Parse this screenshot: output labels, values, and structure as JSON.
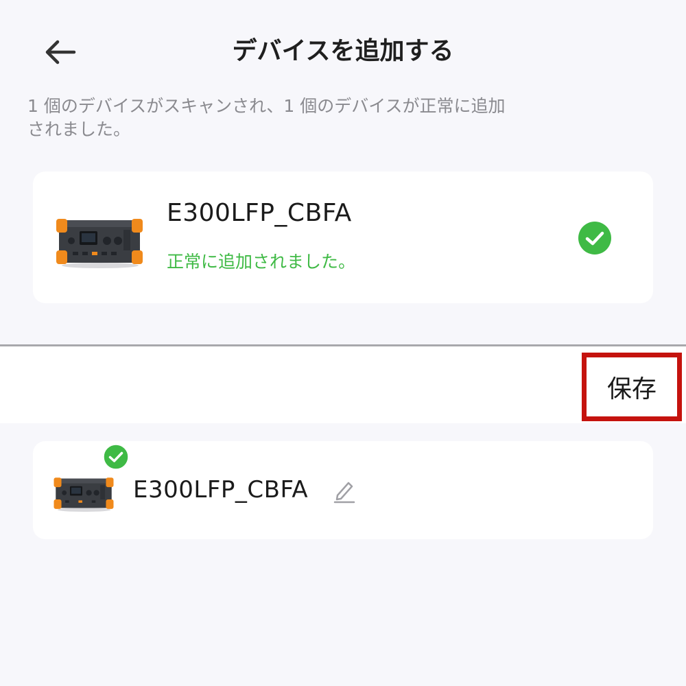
{
  "header": {
    "title": "デバイスを追加する",
    "back_icon": "arrow-left-icon"
  },
  "summary": {
    "line1": "1 個のデバイスがスキャンされ、1 個のデバイスが正常に追加",
    "line2": "されました。"
  },
  "scan_result": {
    "device_name": "E300LFP_CBFA",
    "status_text": "正常に追加されました。",
    "status_icon": "check-circle-icon",
    "status_color": "#3fba45"
  },
  "toolbar": {
    "save_label": "保存",
    "highlight_color": "#c5130e"
  },
  "added_device": {
    "device_name": "E300LFP_CBFA",
    "edit_icon": "pencil-icon",
    "check_icon": "check-circle-icon"
  },
  "colors": {
    "background": "#f7f7fb",
    "card": "#ffffff",
    "device_accent": "#f08a1c",
    "device_body": "#3a3d42"
  }
}
